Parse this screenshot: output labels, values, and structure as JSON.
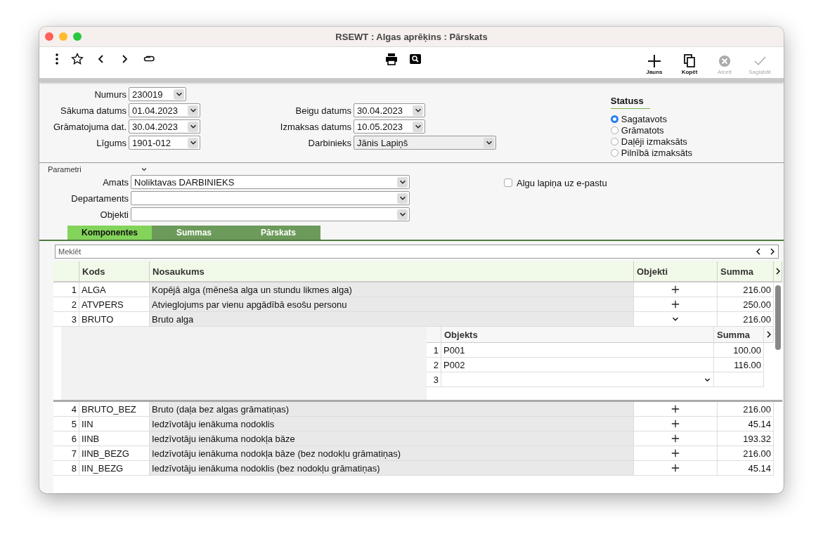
{
  "window": {
    "title": "RSEWT : Algas aprēķins : Pārskats"
  },
  "toolbar": {
    "actions": [
      {
        "kind": "new",
        "label": "Jauns",
        "disabled": false
      },
      {
        "kind": "copy",
        "label": "Kopēt",
        "disabled": false
      },
      {
        "kind": "cancel",
        "label": "Atcelt",
        "disabled": true
      },
      {
        "kind": "save",
        "label": "Saglabāt",
        "disabled": true
      }
    ]
  },
  "form": {
    "left": [
      {
        "label": "Numurs",
        "value": "230019"
      },
      {
        "label": "Sākuma datums",
        "value": "01.04.2023"
      },
      {
        "label": "Grāmatojuma dat.",
        "value": "30.04.2023"
      },
      {
        "label": "Līgums",
        "value": "1901-012"
      }
    ],
    "right": [
      {
        "label": "Beigu datums",
        "value": "30.04.2023"
      },
      {
        "label": "Izmaksas datums",
        "value": "10.05.2023"
      },
      {
        "label": "Darbinieks",
        "value": "Jānis Lapiņš"
      }
    ]
  },
  "status": {
    "title": "Statuss",
    "options": [
      {
        "label": "Sagatavots",
        "selected": true
      },
      {
        "label": "Grāmatots",
        "selected": false
      },
      {
        "label": "Daļēji izmaksāts",
        "selected": false
      },
      {
        "label": "Pilnībā izmaksāts",
        "selected": false
      }
    ]
  },
  "parameters": {
    "title": "Parametri",
    "expanded": true,
    "fields": [
      {
        "label": "Amats",
        "value": "Noliktavas DARBINIEKS"
      },
      {
        "label": "Departaments"
      },
      {
        "label": "Objekti"
      }
    ],
    "checkbox": {
      "label": "Algu lapiņa uz e-pastu",
      "checked": false
    }
  },
  "tabs": [
    {
      "label": "Komponentes",
      "selected": true
    },
    {
      "label": "Summas",
      "selected": false
    },
    {
      "label": "Pārskats",
      "selected": false
    }
  ],
  "search": {
    "placeholder": "Meklēt"
  },
  "table": {
    "columns": [
      "Kods",
      "Nosaukums",
      "Objekti",
      "Summa"
    ],
    "rows": [
      {
        "num": "1",
        "code": "ALGA",
        "name": "Kopējā alga (mēneša alga un stundu likmes alga)",
        "sum": "216.00",
        "expanded": false
      },
      {
        "num": "2",
        "code": "ATVPERS",
        "name": "Atvieglojums par vienu apgādībā esošu personu",
        "sum": "250.00",
        "expanded": false
      },
      {
        "num": "3",
        "code": "BRUTO",
        "name": "Bruto alga",
        "sum": "216.00",
        "expanded": true,
        "objects": {
          "columns": [
            "Objekts",
            "Summa"
          ],
          "rows": [
            {
              "num": "1",
              "object": "P001",
              "sum": "100.00"
            },
            {
              "num": "2",
              "object": "P002",
              "sum": "116.00"
            },
            {
              "num": "3"
            }
          ]
        }
      },
      {
        "num": "4",
        "code": "BRUTO_BEZ",
        "name": "Bruto (daļa bez algas grāmatiņas)",
        "sum": "216.00",
        "expanded": false
      },
      {
        "num": "5",
        "code": "IIN",
        "name": "Iedzīvotāju ienākuma nodoklis",
        "sum": "45.14",
        "expanded": false
      },
      {
        "num": "6",
        "code": "IINB",
        "name": "Iedzīvotāju ienākuma nodokļa bāze",
        "sum": "193.32",
        "expanded": false
      },
      {
        "num": "7",
        "code": "IINB_BEZG",
        "name": "Iedzīvotāju ienākuma nodokļa bāze (bez nodokļu grāmatiņas)",
        "sum": "216.00",
        "expanded": false
      },
      {
        "num": "8",
        "code": "IIN_BEZG",
        "name": "Iedzīvotāju ienākuma nodoklis (bez nodokļu grāmatiņas)",
        "sum": "45.14",
        "expanded": false
      }
    ]
  }
}
